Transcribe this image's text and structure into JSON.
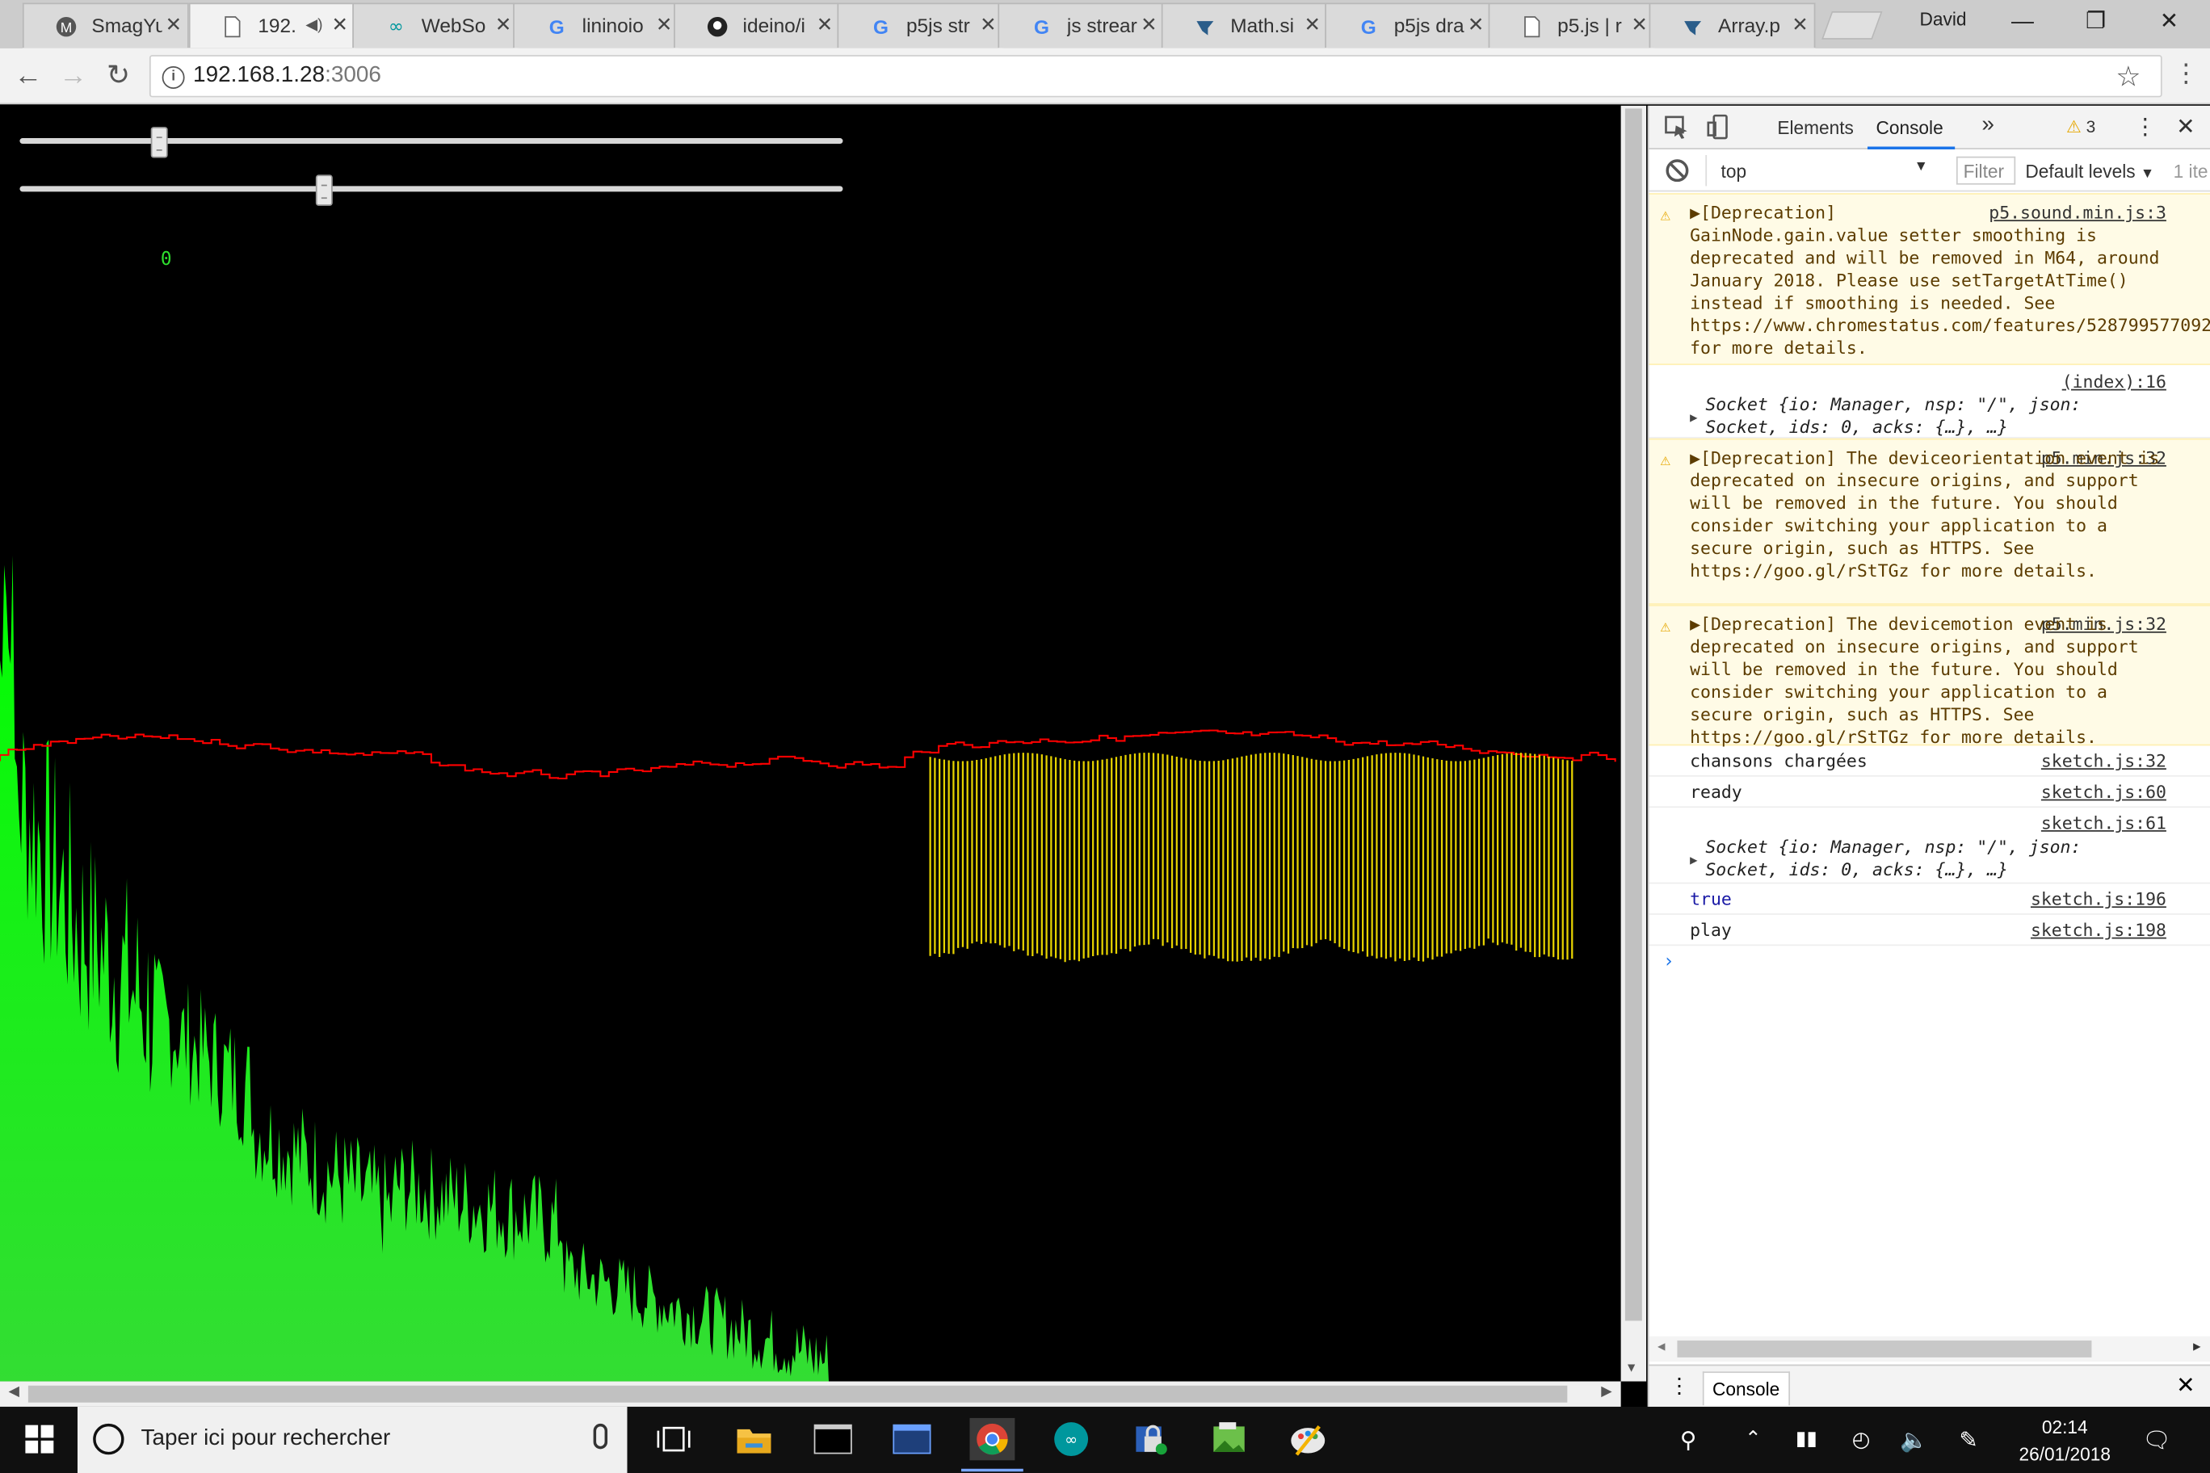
{
  "browser": {
    "tabs": [
      {
        "title": "SmagYu",
        "icon": "gmail-icon",
        "active": false
      },
      {
        "title": "192.",
        "icon": "page-icon",
        "active": true,
        "audio": true
      },
      {
        "title": "WebSo",
        "icon": "arduino-icon",
        "active": false
      },
      {
        "title": "lininoio",
        "icon": "google-icon",
        "active": false
      },
      {
        "title": "ideino/i",
        "icon": "github-icon",
        "active": false
      },
      {
        "title": "p5js str",
        "icon": "google-icon",
        "active": false
      },
      {
        "title": "js strear",
        "icon": "google-icon",
        "active": false
      },
      {
        "title": "Math.si",
        "icon": "mdn-icon",
        "active": false
      },
      {
        "title": "p5js dra",
        "icon": "google-icon",
        "active": false
      },
      {
        "title": "p5.js | r",
        "icon": "page-icon",
        "active": false
      },
      {
        "title": "Array.p",
        "icon": "mdn-icon",
        "active": false
      }
    ],
    "profile": "David",
    "url_host": "192.168.1.28",
    "url_port": ":3006"
  },
  "page": {
    "counter": "0",
    "sliders": [
      0.17,
      0.37
    ]
  },
  "devtools": {
    "tabs": [
      "Elements",
      "Console"
    ],
    "active_tab": "Console",
    "warning_count": "3",
    "context": "top",
    "filter_placeholder": "Filter",
    "levels": "Default levels",
    "items_hidden": "1 ite",
    "drawer_tab": "Console",
    "messages": [
      {
        "type": "warn",
        "text": "▶[Deprecation]\nGainNode.gain.value setter smoothing is deprecated and will be removed in M64, around January 2018. Please use setTargetAtTime() instead if smoothing is needed. See https://www.chromestatus.com/features/5287995770929152 for more details.",
        "source": "p5.sound.min.js:3"
      },
      {
        "type": "log",
        "text": "Socket {io: Manager, nsp: \"/\", json: Socket, ids: 0, acks: {…}, …}",
        "source": "(index):16"
      },
      {
        "type": "warn",
        "text": "▶[Deprecation] The deviceorientation event is deprecated on insecure origins, and support will be removed in the future. You should consider switching your application to a secure origin, such as HTTPS. See https://goo.gl/rStTGz for more details.",
        "source": "p5.min.js:32"
      },
      {
        "type": "warn",
        "text": "▶[Deprecation] The devicemotion event is deprecated on insecure origins, and support will be removed in the future. You should consider switching your application to a secure origin, such as HTTPS. See https://goo.gl/rStTGz for more details.",
        "source": "p5.min.js:32"
      },
      {
        "type": "log",
        "text": "chansons chargées",
        "source": "sketch.js:32"
      },
      {
        "type": "log",
        "text": "ready",
        "source": "sketch.js:60"
      },
      {
        "type": "log",
        "text": "Socket {io: Manager, nsp: \"/\", json: Socket, ids: 0, acks: {…}, …}",
        "source": "sketch.js:61"
      },
      {
        "type": "log",
        "text": "true",
        "source": "sketch.js:196"
      },
      {
        "type": "log",
        "text": "play",
        "source": "sketch.js:198"
      }
    ]
  },
  "taskbar": {
    "search_placeholder": "Taper ici pour rechercher",
    "time": "02:14",
    "date": "26/01/2018"
  },
  "colors": {
    "spectrum": "#00ff00",
    "waveform": "#ff0000",
    "bars": "#e6d200",
    "counter": "#2ee02e"
  }
}
